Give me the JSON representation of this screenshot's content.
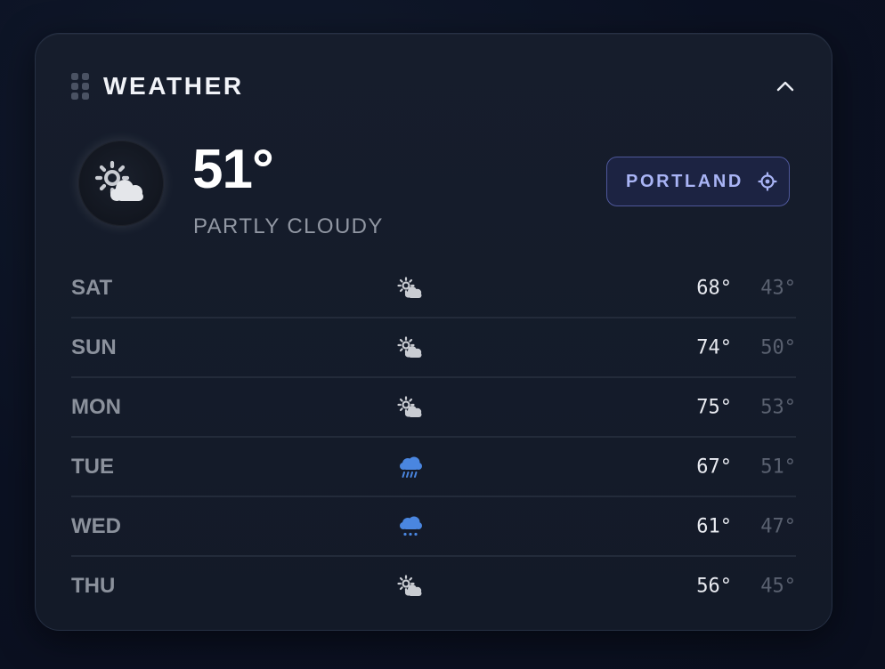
{
  "widget": {
    "title": "WEATHER"
  },
  "current": {
    "temperature": "51°",
    "condition": "PARTLY CLOUDY",
    "icon": "partly-cloudy-icon",
    "location": "PORTLAND"
  },
  "forecast": [
    {
      "day": "SAT",
      "icon": "partly-cloudy-icon",
      "high": "68°",
      "low": "43°"
    },
    {
      "day": "SUN",
      "icon": "partly-cloudy-icon",
      "high": "74°",
      "low": "50°"
    },
    {
      "day": "MON",
      "icon": "partly-cloudy-icon",
      "high": "75°",
      "low": "53°"
    },
    {
      "day": "TUE",
      "icon": "rain-icon",
      "high": "67°",
      "low": "51°"
    },
    {
      "day": "WED",
      "icon": "showers-icon",
      "high": "61°",
      "low": "47°"
    },
    {
      "day": "THU",
      "icon": "partly-cloudy-icon",
      "high": "56°",
      "low": "45°"
    }
  ],
  "colors": {
    "accent": "#a9b4f5",
    "rain": "#4a86e0"
  }
}
